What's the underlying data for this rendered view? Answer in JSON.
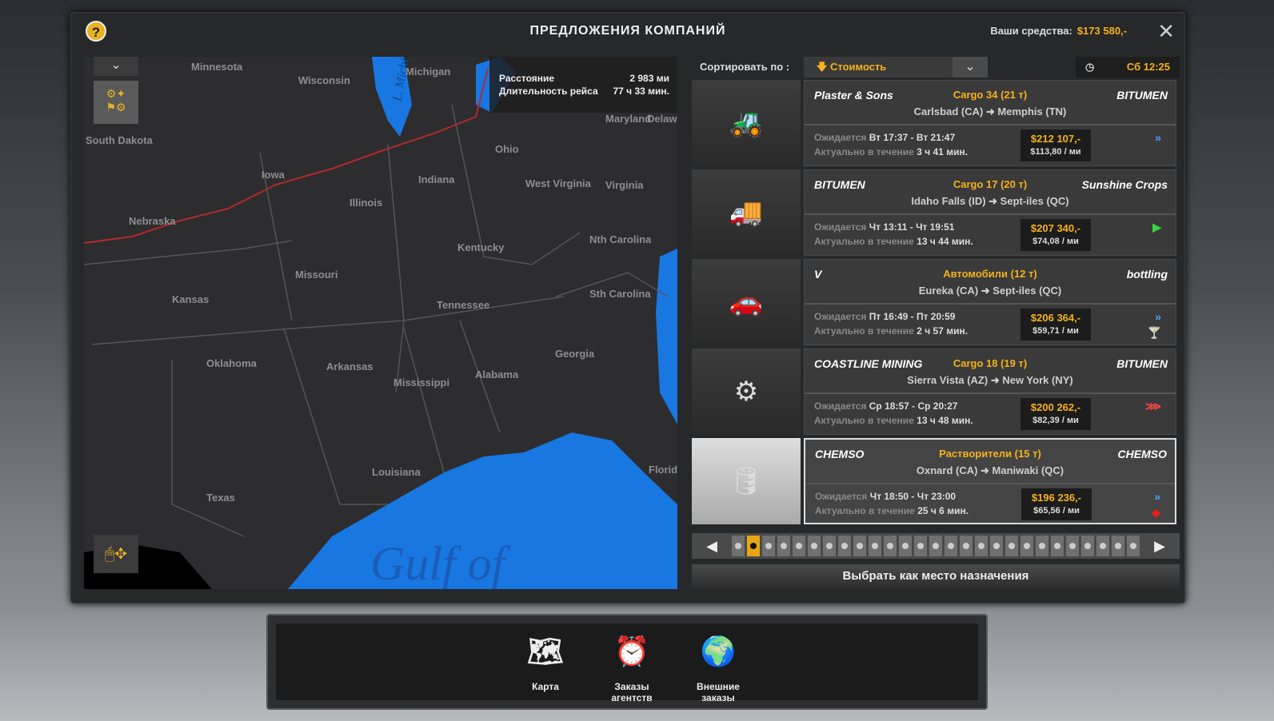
{
  "window": {
    "title": "ПРЕДЛОЖЕНИЯ КОМПАНИЙ",
    "funds_label": "Ваши средства:",
    "funds_value": "$173 580,-",
    "help": "?",
    "close": "✕"
  },
  "map": {
    "distance_label": "Расстояние",
    "distance_value": "2 983 ми",
    "duration_label": "Длительность рейса",
    "duration_value": "77 ч 33 мин.",
    "water_label": "Gulf of",
    "lake_label": "L. Michi",
    "states": [
      "Minnesota",
      "Wisconsin",
      "Michigan",
      "South Dakota",
      "Iowa",
      "Nebraska",
      "Illinois",
      "Indiana",
      "Ohio",
      "West Virginia",
      "Virginia",
      "Kentucky",
      "Nth Carolina",
      "Missouri",
      "Kansas",
      "Tennessee",
      "Sth Carolina",
      "Oklahoma",
      "Arkansas",
      "Mississippi",
      "Alabama",
      "Georgia",
      "Louisiana",
      "Texas",
      "Florid",
      "Maryland",
      "Delaw"
    ]
  },
  "sort": {
    "label": "Сортировать по :",
    "value": "Стоимость",
    "time": "Сб 12:25"
  },
  "jobs": [
    {
      "cargo": "Cargo 34 (21 т)",
      "route": "Carlsbad (CA) ➜ Memphis (TN)",
      "from_company": "Plaster & Sons",
      "to_company": "BITUMEN",
      "expected_label": "Ожидается",
      "expected": "Вт 17:37 - Вт 21:47",
      "valid_label": "Актуально в течение",
      "valid": "3 ч 41 мин.",
      "price": "$212 107,-",
      "per_mile": "$113,80 / ми",
      "icons": [
        "fast-icon"
      ]
    },
    {
      "cargo": "Cargo 17  (20 т)",
      "route": "Idaho Falls (ID) ➜ Sept-iles (QC)",
      "from_company": "BITUMEN",
      "to_company": "Sunshine Crops",
      "expected_label": "Ожидается",
      "expected": "Чт 13:11 - Чт 19:51",
      "valid_label": "Актуально в течение",
      "valid": "13 ч 44 мин.",
      "price": "$207 340,-",
      "per_mile": "$74,08 / ми",
      "icons": [
        "normal-icon"
      ]
    },
    {
      "cargo": "Автомобили (12 т)",
      "route": "Eureka (CA) ➜ Sept-iles (QC)",
      "from_company": "V",
      "to_company": "bottling",
      "expected_label": "Ожидается",
      "expected": "Пт 16:49 - Пт 20:59",
      "valid_label": "Актуально в течение",
      "valid": "2 ч 57 мин.",
      "price": "$206 364,-",
      "per_mile": "$59,71 / ми",
      "icons": [
        "fast-icon",
        "fragile-icon"
      ]
    },
    {
      "cargo": "Cargo 18  (19 т)",
      "route": "Sierra Vista (AZ) ➜ New York (NY)",
      "from_company": "COASTLINE MINING",
      "to_company": "BITUMEN",
      "expected_label": "Ожидается",
      "expected": "Ср 18:57 - Ср 20:27",
      "valid_label": "Актуально в течение",
      "valid": "13 ч 48 мин.",
      "price": "$200 262,-",
      "per_mile": "$82,39 / ми",
      "icons": [
        "urgent-icon"
      ]
    },
    {
      "cargo": "Растворители (15 т)",
      "route": "Oxnard (CA) ➜ Maniwaki (QC)",
      "from_company": "CHEMSO",
      "to_company": "CHEMSO",
      "expected_label": "Ожидается",
      "expected": "Чт 18:50 - Чт 23:00",
      "valid_label": "Актуально в течение",
      "valid": "25 ч 6 мин.",
      "price": "$196 236,-",
      "per_mile": "$65,56 / ми",
      "icons": [
        "fast-icon",
        "hazard-icon"
      ]
    }
  ],
  "pager": {
    "pages": 27,
    "current": 2
  },
  "choose_label": "Выбрать как место назначения",
  "dock": [
    {
      "label": "Карта"
    },
    {
      "label": "Заказы агентств"
    },
    {
      "label": "Внешние заказы"
    }
  ],
  "colors": {
    "accent": "#f5b21b",
    "water": "#1877e0",
    "map_bg": "#2d2c2e",
    "route": "#b22a2a"
  }
}
